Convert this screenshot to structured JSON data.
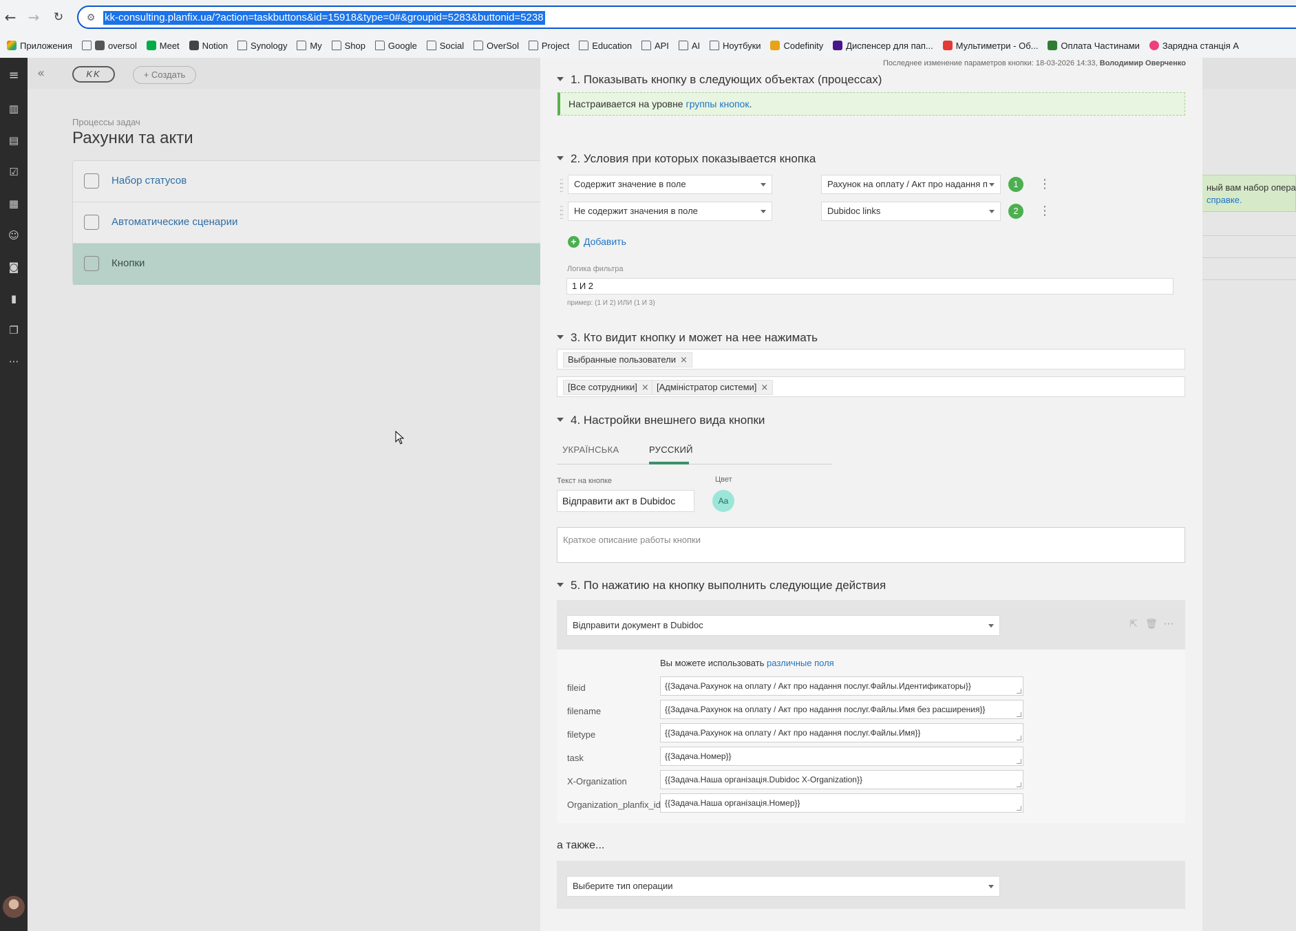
{
  "browser": {
    "url": "kk-consulting.planfix.ua/?action=taskbuttons&id=15918&type=0#&groupid=5283&buttonid=5238",
    "bookmarks": [
      "Приложения",
      "oversol",
      "Meet",
      "Notion",
      "Synology",
      "My",
      "Shop",
      "Google",
      "Social",
      "OverSol",
      "Project",
      "Education",
      "API",
      "AI",
      "Ноутбуки",
      "Codefinity",
      "Диспенсер для пап...",
      "Мультиметри - Об...",
      "Оплата Частинами",
      "Зарядна станція A"
    ]
  },
  "app": {
    "create_label": "+ Создать",
    "logo_text": "KK",
    "breadcrumb": "Процессы задач",
    "page_title": "Рахунки та акти",
    "menu": [
      "Набор статусов",
      "Автоматические сценарии",
      "Кнопки"
    ],
    "side_note_line1": "ный вам набор опера",
    "side_note_line2": "справке."
  },
  "panel": {
    "last_modified_label": "Последнее изменение параметров кнопки: 18-03-2026 14:33,",
    "last_modified_user": "Володимир Оверченко",
    "section1_title": "1. Показывать кнопку в следующих объектах (процессах)",
    "section1_note_prefix": "Настраивается на уровне",
    "section1_note_link": "группы кнопок",
    "section2_title": "2. Условия при которых показывается кнопка",
    "conditions": [
      {
        "op": "Содержит значение в поле",
        "field": "Рахунок на оплату / Акт про надання п",
        "num": "1"
      },
      {
        "op": "Не содержит значения в поле",
        "field": "Dubidoc links",
        "num": "2"
      }
    ],
    "add_label": "Добавить",
    "filter_logic_label": "Логика фильтра",
    "filter_logic_value": "1 И 2",
    "filter_example": "пример: (1 И 2) ИЛИ (1 И 3)",
    "section3_title": "3. Кто видит кнопку и может на нее нажимать",
    "who_tag": "Выбранные пользователи",
    "users_tags": [
      "[Все сотрудники]",
      "[Адміністратор системи]"
    ],
    "section4_title": "4. Настройки внешнего вида кнопки",
    "lang_tabs": [
      "УКРАЇНСЬКА",
      "РУССКИЙ"
    ],
    "button_text_label": "Текст на кнопке",
    "button_text_value": "Відправити акт в Dubidoc",
    "color_label": "Цвет",
    "color_sample": "Aa",
    "description_placeholder": "Краткое описание работы кнопки",
    "section5_title": "5. По нажатию на кнопку выполнить следующие действия",
    "action_select": "Відправити документ в Dubidoc",
    "fields_hint_prefix": "Вы можете использовать",
    "fields_hint_link": "различные поля",
    "params": [
      {
        "name": "fileid",
        "value": "{{Задача.Рахунок на оплату / Акт про надання послуг.Файлы.Идентификаторы}}"
      },
      {
        "name": "filename",
        "value": "{{Задача.Рахунок на оплату / Акт про надання послуг.Файлы.Имя без расширения}}"
      },
      {
        "name": "filetype",
        "value": "{{Задача.Рахунок на оплату / Акт про надання послуг.Файлы.Имя}}"
      },
      {
        "name": "task",
        "value": "{{Задача.Номер}}"
      },
      {
        "name": "X-Organization",
        "value": "{{Задача.Наша організація.Dubidoc X-Organization}}"
      },
      {
        "name": "Organization_planfix_id",
        "value": "{{Задача.Наша організація.Номер}}"
      }
    ],
    "also_label": "а также...",
    "operation_select": "Выберите тип операции"
  },
  "colors": {
    "accent": "#4caf50",
    "link": "#1f74c4",
    "active_menu": "#b7d0c8"
  }
}
